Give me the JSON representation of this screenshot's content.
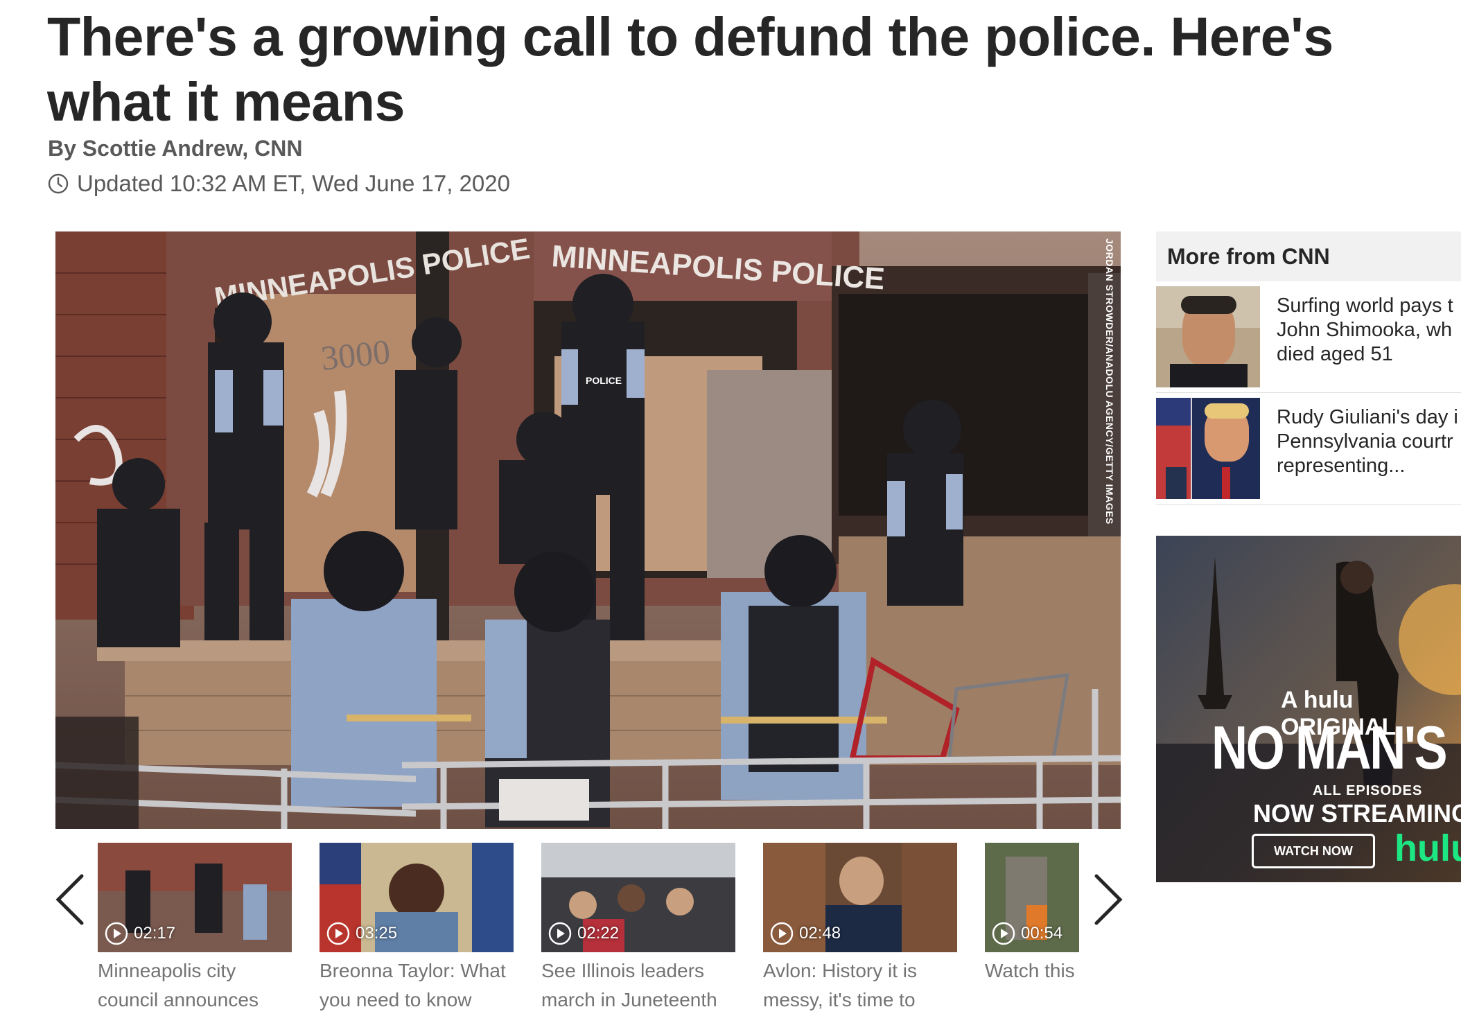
{
  "article": {
    "headline": "There's a growing call to defund the police. Here's what it means",
    "byline": "By Scottie Andrew, CNN",
    "updated": "Updated 10:32 AM ET, Wed June 17, 2020"
  },
  "hero": {
    "credit": "JORDAN STROWDER/ANADOLU AGENCY/GETTY IMAGES",
    "sign_left": "MINNEAPOLIS POLICE",
    "sign_right": "MINNEAPOLIS POLICE",
    "building_number": "3000",
    "vest_label": "POLICE"
  },
  "carousel": {
    "videos": [
      {
        "duration": "02:17",
        "caption": "Minneapolis city council announces"
      },
      {
        "duration": "03:25",
        "caption": "Breonna Taylor: What you need to know"
      },
      {
        "duration": "02:22",
        "caption": "See Illinois leaders march in Juneteenth"
      },
      {
        "duration": "02:48",
        "caption": "Avlon: History it is messy, it's time to"
      },
      {
        "duration": "00:54",
        "caption": "Watch this Confederat"
      }
    ]
  },
  "sidebar": {
    "heading": "More from CNN",
    "items": [
      {
        "title_lines": [
          "Surfing world pays t",
          "John Shimooka, wh",
          "died aged 51"
        ]
      },
      {
        "title_lines": [
          "Rudy Giuliani's day i",
          "Pennsylvania courtr",
          "representing..."
        ]
      }
    ]
  },
  "ad": {
    "tagline": "A hulu ORIGINAL",
    "title": "NO MAN'S LA",
    "all_episodes": "ALL EPISODES",
    "now_streaming": "NOW STREAMING",
    "button": "WATCH NOW",
    "logo": "hulu"
  },
  "colors": {
    "headline": "#262626",
    "meta": "#595959",
    "caption": "#737373",
    "rail_head_bg": "#f1f1f1",
    "hulu_green": "#1ce783"
  }
}
